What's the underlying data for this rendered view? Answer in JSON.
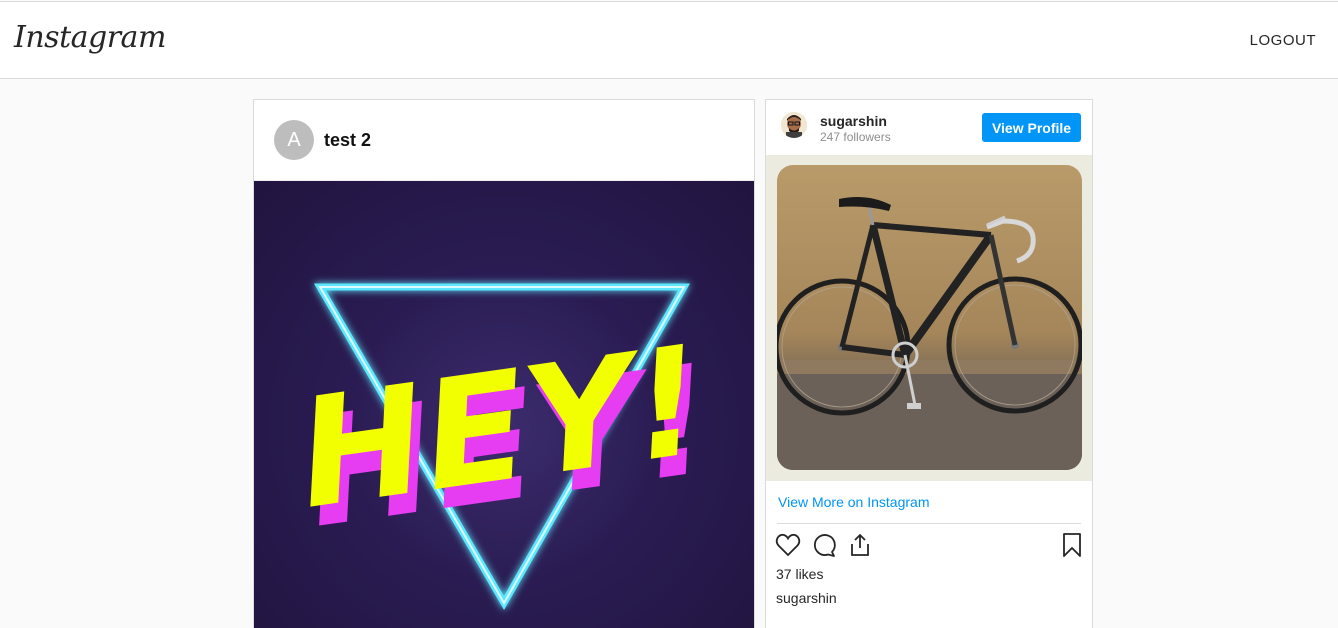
{
  "nav": {
    "logo_text": "Instagram",
    "logout_label": "LOGOUT"
  },
  "post": {
    "avatar_letter": "A",
    "username": "test 2",
    "image_icon": "neon-hey-triangle-image"
  },
  "embed": {
    "username": "sugarshin",
    "followers": "247 followers",
    "view_profile_label": "View Profile",
    "media_icon": "bicycle-photo",
    "view_more_label": "View More on Instagram",
    "likes": "37 likes",
    "caption_username": "sugarshin",
    "action_icons": [
      "heart-icon",
      "comment-icon",
      "share-icon",
      "bookmark-icon"
    ]
  },
  "colors": {
    "accent": "#0095f6",
    "background": "#fafafa",
    "border": "#dbdbdb"
  }
}
